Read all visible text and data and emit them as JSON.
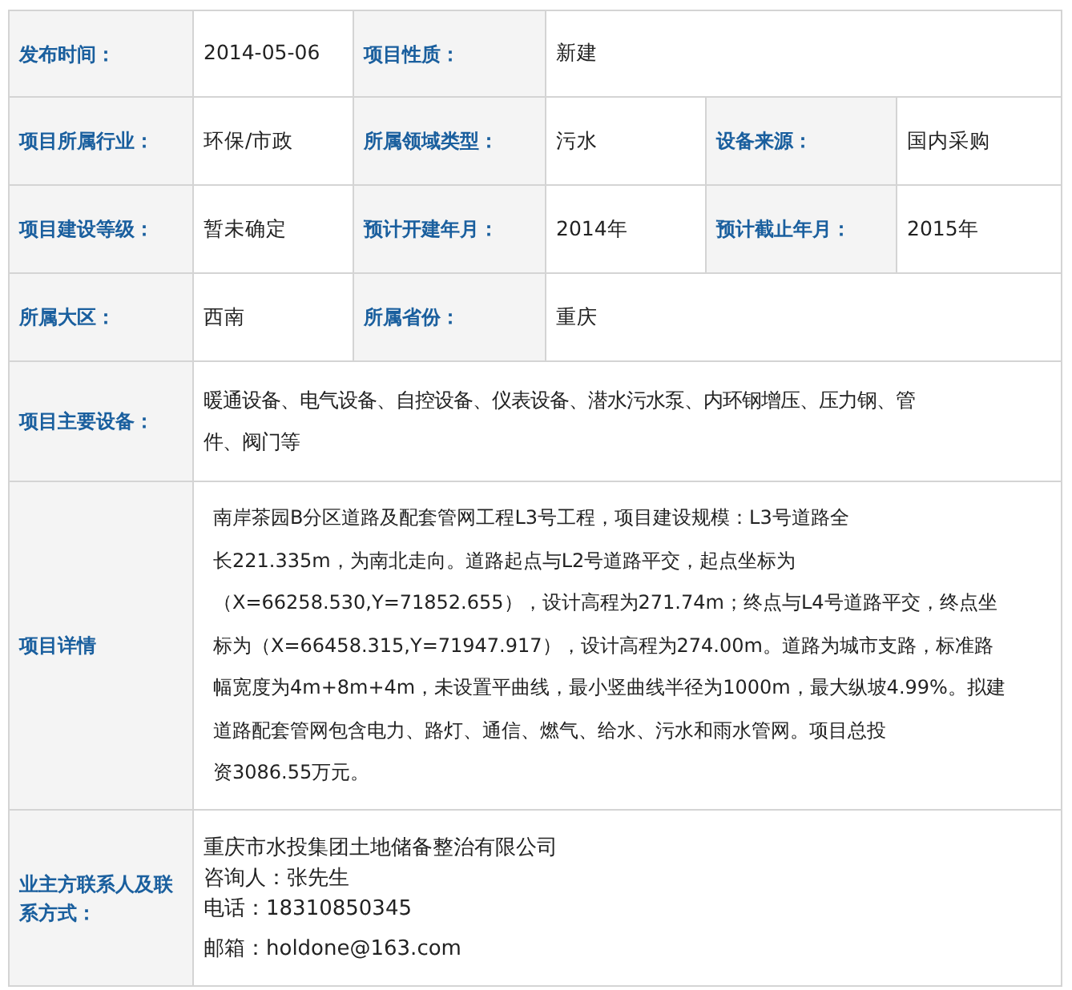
{
  "rows": [
    [
      {
        "kind": "label",
        "text": "发布时间："
      },
      {
        "kind": "value",
        "text": "2014-05-06"
      },
      {
        "kind": "label",
        "text": "项目性质："
      },
      {
        "kind": "value",
        "text": "新建"
      }
    ],
    [
      {
        "kind": "label",
        "text": "项目所属行业："
      },
      {
        "kind": "value",
        "text": "环保/市政"
      },
      {
        "kind": "label",
        "text": "所属领域类型："
      },
      {
        "kind": "value",
        "text": "污水"
      },
      {
        "kind": "label",
        "text": "设备来源："
      },
      {
        "kind": "value",
        "text": "国内采购"
      }
    ],
    [
      {
        "kind": "label",
        "text": "项目建设等级："
      },
      {
        "kind": "value",
        "text": "暂未确定"
      },
      {
        "kind": "label",
        "text": "预计开建年月："
      },
      {
        "kind": "value",
        "text": "2014年"
      },
      {
        "kind": "label",
        "text": "预计截止年月："
      },
      {
        "kind": "value",
        "text": "2015年"
      }
    ],
    [
      {
        "kind": "label",
        "text": "所属大区："
      },
      {
        "kind": "value",
        "text": "西南"
      },
      {
        "kind": "label",
        "text": "所属省份："
      },
      {
        "kind": "value",
        "text": "重庆"
      }
    ],
    [
      {
        "kind": "label",
        "text": "项目主要设备："
      },
      {
        "kind": "paragraph",
        "lines": [
          "暖通设备、电气设备、自控设备、仪表设备、潜水污水泵、内环钢增压、压力钢、管",
          "件、阀门等"
        ]
      }
    ],
    [
      {
        "kind": "label",
        "text": "项目详情"
      },
      {
        "kind": "details",
        "lines": [
          "南岸茶园B分区道路及配套管网工程L3号工程，项目建设规模：L3号道路全",
          "长221.335m，为南北走向。道路起点与L2号道路平交，起点坐标为",
          "（X=66258.530,Y=71852.655），设计高程为271.74m；终点与L4号道路平交，终点坐",
          "标为（X=66458.315,Y=71947.917），设计高程为274.00m。道路为城市支路，标准路",
          "幅宽度为4m+8m+4m，未设置平曲线，最小竖曲线半径为1000m，最大纵坡4.99%。拟建",
          "道路配套管网包含电力、路灯、通信、燃气、给水、污水和雨水管网。项目总投",
          "资3086.55万元。"
        ]
      }
    ],
    [
      {
        "kind": "label",
        "text": "业主方联系人及联系方式："
      },
      {
        "kind": "contact",
        "lines": [
          "重庆市水投集团土地储备整治有限公司",
          "咨询人：张先生",
          "电话：18310850345",
          "邮箱：holdone@163.com"
        ]
      }
    ]
  ]
}
